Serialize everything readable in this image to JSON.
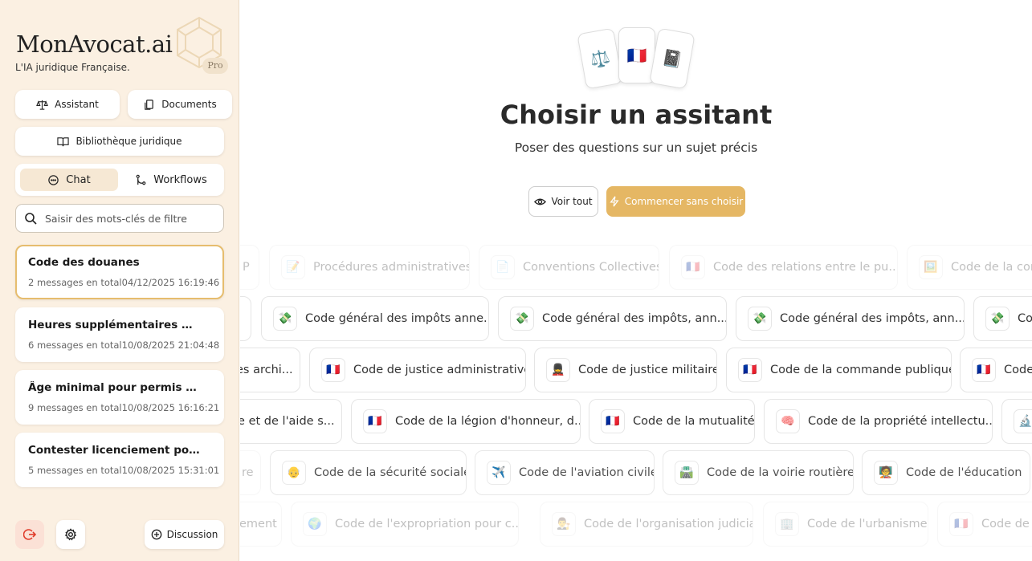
{
  "sidebar": {
    "brand": "MonAvocat.ai",
    "tagline": "L'IA juridique Française.",
    "pro_badge": "Pro",
    "nav": {
      "assistant": "Assistant",
      "documents": "Documents",
      "library": "Bibliothèque juridique"
    },
    "mode_tabs": {
      "chat": "Chat",
      "workflows": "Workflows",
      "active": "chat"
    },
    "search": {
      "placeholder": "Saisir des mots-clés de filtre",
      "value": ""
    },
    "conversations": [
      {
        "title": "Code des douanes",
        "count": "2 messages en total",
        "date": "04/12/2025 16:19:46",
        "selected": true
      },
      {
        "title": "Heures supplémentaires no...",
        "count": "6 messages en total",
        "date": "10/08/2025 21:04:48"
      },
      {
        "title": "Âge minimal pour permis co...",
        "count": "9 messages en total",
        "date": "10/08/2025 16:16:21"
      },
      {
        "title": "Contester licenciement pour...",
        "count": "5 messages en total",
        "date": "10/08/2025 15:31:01"
      }
    ],
    "footer": {
      "discussion": "Discussion"
    }
  },
  "main": {
    "card_icons": [
      "⚖️",
      "🇫🇷",
      "📓"
    ],
    "title": "Choisir un assitant",
    "subtitle": "Poser des questions sur un sujet précis",
    "voir_tout": "Voir tout",
    "start": "Commencer sans choisir"
  },
  "chips": {
    "r1": {
      "a": "P",
      "b": "Procédures administratives",
      "c": "Conventions Collectives",
      "d": "Code des relations entre le pu...",
      "e": "Code de la con"
    },
    "r2": {
      "b": "Code général des impôts anne...",
      "c": "Code général des impôts, ann...",
      "d": "Code général des impôts, ann...",
      "e": "Co"
    },
    "r3": {
      "a": "es archi...",
      "b": "Code de justice administrative",
      "c": "Code de justice militaire",
      "d": "Code de la commande publique",
      "e": "Code"
    },
    "r4": {
      "a": "lle et de l'aide s...",
      "b": "Code de la légion d'honneur, d...",
      "c": "Code de la mutualité",
      "d": "Code de la propriété intellectu..."
    },
    "r5": {
      "a": "re",
      "b": "Code de la sécurité sociale",
      "c": "Code de l'aviation civile",
      "d": "Code de la voirie routière",
      "e": "Code de l'éducation"
    },
    "r6": {
      "a": "ement",
      "b": "Code de l'expropriation pour c...",
      "c": "Code de l'organisation judiciaire",
      "d": "Code de l'urbanisme",
      "e": "Code de"
    }
  },
  "colors": {
    "sidebar_bg": "#fbf0e2",
    "accent": "#e5b764",
    "selected_border": "#e6bd6e"
  }
}
